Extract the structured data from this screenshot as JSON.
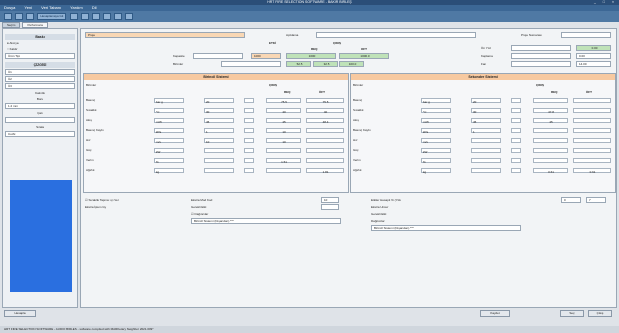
{
  "window": {
    "title": "HRT FIRE SELECTION SOFTWARE - BAKIR BİRLEŞ",
    "controls": "_ □ ×"
  },
  "menu": [
    "Dosya",
    "Yeni",
    "Veri Tabanı",
    "Yardım",
    "Dil"
  ],
  "toolbar": [
    "",
    "",
    "",
    "Hesaplamaya Git",
    "",
    "",
    "",
    "",
    "",
    ""
  ],
  "tabs": [
    {
      "label": "Seçim"
    },
    {
      "label": "Performans"
    }
  ],
  "sidebar": {
    "section1": "Baskı",
    "options": [
      "● Alıcıya",
      "○ Kaldır"
    ],
    "field1": "Ürün Tipi",
    "section2": "ÇİZGİSİ",
    "fields": [
      "Ü1",
      "Ü2",
      "Ü3"
    ],
    "sub1": "Kalınlık",
    "sub2": "Boru",
    "field_mm": "1.2 mm",
    "sub3": "Çatı",
    "field_cati": "",
    "sub4": "Sırala",
    "field_last": "Cu/Al"
  },
  "main": {
    "top_label": "Proje",
    "mid_label": "Açıklama",
    "right_label": "Proje Numarası",
    "col_heads": [
      "ETKİ",
      "ÇIKIŞ"
    ],
    "sub_heads": [
      "REQ",
      "OFT"
    ],
    "row1_label": "Kapasite",
    "row1_values": [
      "",
      "1000",
      "1000",
      "1000.0"
    ],
    "row2_label": "Birimler",
    "row2_values": [
      "",
      "52.5",
      "32.5",
      "100.0"
    ],
    "right_fields": [
      "Ön Yüz",
      "Kaplama",
      "Fan"
    ],
    "right_values": [
      "0.00",
      "0.00",
      "14.00"
    ]
  },
  "panels": [
    {
      "title": "Birincil Sistemi",
      "head": [
        "Birimler",
        "ÇIKIŞ"
      ],
      "cols": [
        "REQ",
        "ÖFT"
      ],
      "rows": [
        {
          "label": "Basınç",
          "a": "bar g",
          "b": "20",
          "c": "75.5",
          "d": "75.5"
        },
        {
          "label": "Sıcaklık",
          "a": "°C",
          "b": "30",
          "c": "40",
          "d": "40"
        },
        {
          "label": "Akış",
          "a": "m³/h",
          "b": "45",
          "c": "45",
          "d": "48.4"
        },
        {
          "label": "Basınç Kaybı",
          "a": "kPa",
          "b": "1",
          "c": "10",
          "d": ""
        },
        {
          "label": "Hız",
          "a": "m/s",
          "b": "10",
          "c": "10",
          "d": ""
        },
        {
          "label": "Güç",
          "a": "kW",
          "b": "",
          "c": "",
          "d": ""
        },
        {
          "label": "Verim",
          "a": "%",
          "b": "",
          "c": "1.51",
          "d": ""
        },
        {
          "label": "Ağırlık",
          "a": "kg",
          "b": "",
          "c": "",
          "d": "1.81"
        }
      ]
    },
    {
      "title": "Sekonder Sistemi",
      "head": [
        "Birimler",
        "ÇIKIŞ"
      ],
      "cols": [
        "REQ",
        "ÖFT"
      ],
      "rows": [
        {
          "label": "Basınç",
          "a": "bar g",
          "b": "20",
          "c": "",
          "d": ""
        },
        {
          "label": "Sıcaklık",
          "a": "°C",
          "b": "30",
          "c": "47.8",
          "d": ""
        },
        {
          "label": "Akış",
          "a": "m³/h",
          "b": "45",
          "c": "45",
          "d": ""
        },
        {
          "label": "Basınç Kaybı",
          "a": "kPa",
          "b": "1",
          "c": "",
          "d": ""
        },
        {
          "label": "Hız",
          "a": "m/s",
          "b": "",
          "c": "",
          "d": ""
        },
        {
          "label": "Güç",
          "a": "kW",
          "b": "",
          "c": "",
          "d": ""
        },
        {
          "label": "Verim",
          "a": "%",
          "b": "",
          "c": "",
          "d": ""
        },
        {
          "label": "Ağırlık",
          "a": "kg",
          "b": "",
          "c": "0.61",
          "d": "0.61"
        }
      ]
    }
  ],
  "lower": {
    "left_check": "☑ Sıcaklık Taşma: ıçı Ver",
    "left_label1": "Ekstra Mod Kod",
    "left_label2": "Ekstra İşlem Gy",
    "left_label3": "Gerekli Etki",
    "left_check2": "☑ Dağıtıcılar",
    "left_dropdown": "Birincil Sistemi (Dışarıdan) ***",
    "right_label1": "Etkiler Hesaplı %  (Yük",
    "right_label2": "Ekstra Unsur",
    "right_label3": "Gerekli Etki",
    "right_check2": "Dağıtıcılar",
    "right_dropdown": "Birincil Sistemi (Dışarıdan) ***",
    "small_values": [
      "10",
      "",
      "0",
      "",
      "7"
    ]
  },
  "footer": {
    "left_btn": "Hesapla",
    "mid_btn": "Kaydet",
    "right_btns": [
      "Seç",
      "Çıkış"
    ]
  },
  "status": "HRT FIRE SELECTION SOFTWARE - AUDIO BIRLES - software compiled with MARKetary Neighbor 2021.009°"
}
